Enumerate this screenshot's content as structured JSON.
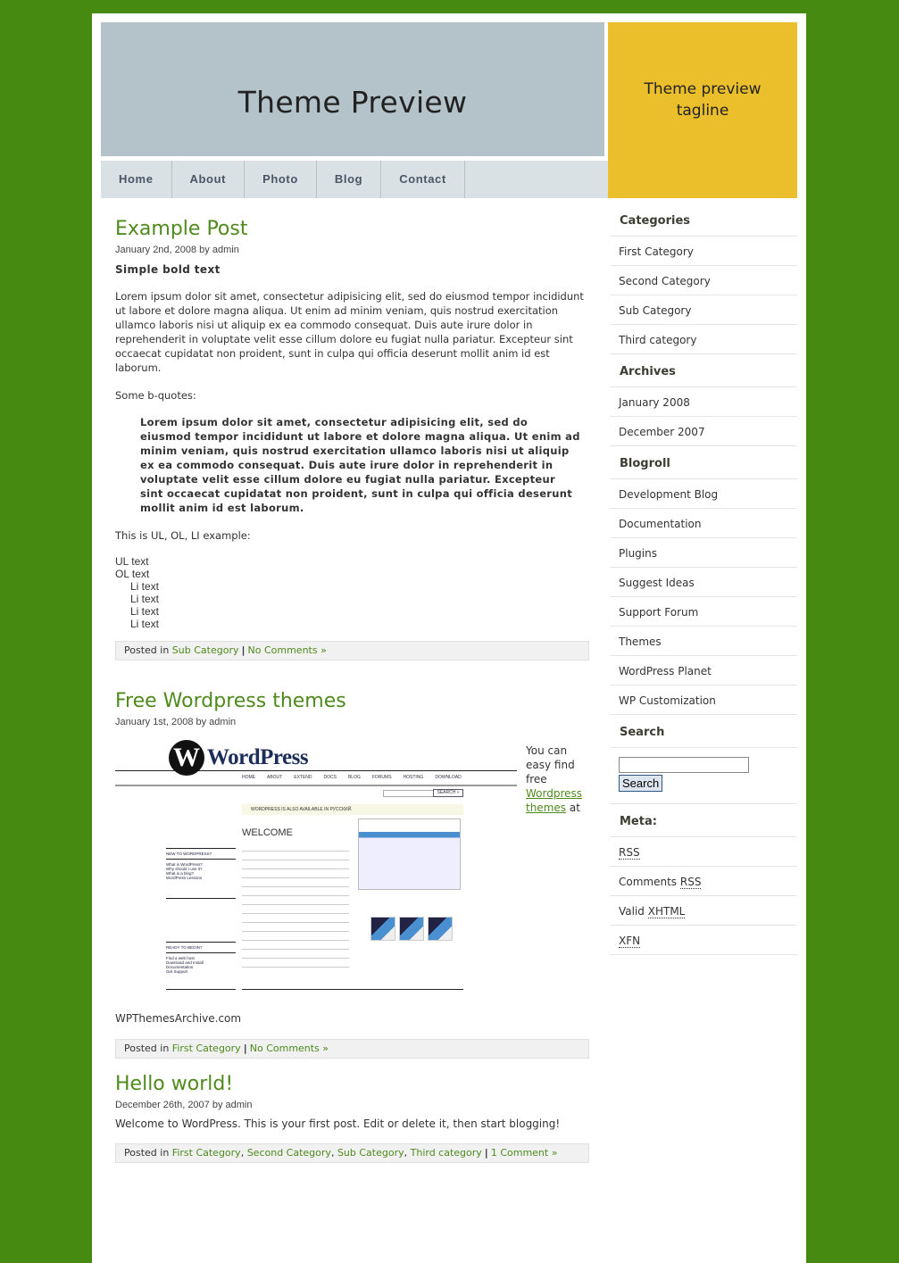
{
  "site": {
    "title": "Theme Preview",
    "tagline": "Theme preview tagline"
  },
  "colors": {
    "background": "#468a12",
    "header": "#b4c3c9",
    "tagline_box": "#ebbf2b",
    "nav": "#d9e1e5",
    "accent": "#4f8a1d"
  },
  "nav": [
    "Home",
    "About",
    "Photo",
    "Blog",
    "Contact"
  ],
  "posts": [
    {
      "title": "Example Post",
      "meta": "January 2nd, 2008 by admin",
      "bold": "Simple bold text",
      "para": "Lorem ipsum dolor sit amet, consectetur adipisicing elit, sed do eiusmod tempor incididunt ut labore et dolore magna aliqua. Ut enim ad minim veniam, quis nostrud exercitation ullamco laboris nisi ut aliquip ex ea commodo consequat. Duis aute irure dolor in reprehenderit in voluptate velit esse cillum dolore eu fugiat nulla pariatur. Excepteur sint occaecat cupidatat non proident, sunt in culpa qui officia deserunt mollit anim id est laborum.",
      "bq_intro": "Some b-quotes:",
      "blockquote": "Lorem ipsum dolor sit amet, consectetur adipisicing elit, sed do eiusmod tempor incididunt ut labore et dolore magna aliqua. Ut enim ad minim veniam, quis nostrud exercitation ullamco laboris nisi ut aliquip ex ea commodo consequat. Duis aute irure dolor in reprehenderit in voluptate velit esse cillum dolore eu fugiat nulla pariatur. Excepteur sint occaecat cupidatat non proident, sunt in culpa qui officia deserunt mollit anim id est laborum.",
      "list_intro": "This is UL, OL, LI example:",
      "ul": "UL text",
      "ol": "OL text",
      "li": [
        "Li text",
        "Li text",
        "Li text",
        "Li text"
      ],
      "posted_in": "Posted in",
      "categories": [
        "Sub Category"
      ],
      "comments": "No Comments »"
    },
    {
      "title": "Free Wordpress themes",
      "meta": "January 1st, 2008 by admin",
      "side_text": "You can easy find free",
      "side_link": "Wordpress themes",
      "side_after": "at",
      "caption": "WPThemesArchive.com",
      "posted_in": "Posted in",
      "categories": [
        "First Category"
      ],
      "comments": "No Comments »",
      "image": {
        "logo_text": "WordPress",
        "nav": [
          "HOME",
          "ABOUT",
          "EXTEND",
          "DOCS",
          "BLOG",
          "FORUMS",
          "HOSTING",
          "DOWNLOAD"
        ],
        "search": "SEARCH »",
        "notice": "WORDPRESS IS ALSO AVAILABLE IN РУССКИЙ.",
        "welcome": "WELCOME",
        "new_heading": "NEW TO WORDPRESS?",
        "new_links": [
          "What is WordPress?",
          "Why should I use it?",
          "What is a blog?",
          "WordPress Lessons"
        ],
        "ready_heading": "READY TO BEGIN?",
        "ready_links": [
          "Find a web host",
          "Download and Install",
          "Documentation",
          "Get Support"
        ]
      }
    },
    {
      "title": "Hello world!",
      "meta": "December 26th, 2007 by admin",
      "para": "Welcome to WordPress. This is your first post. Edit or delete it, then start blogging!",
      "posted_in": "Posted in",
      "categories": [
        "First Category",
        "Second Category",
        "Sub Category",
        "Third category"
      ],
      "comments": "1 Comment »"
    }
  ],
  "sidebar": {
    "categories": {
      "title": "Categories",
      "items": [
        "First Category",
        "Second Category",
        "Sub Category",
        "Third category"
      ]
    },
    "archives": {
      "title": "Archives",
      "items": [
        "January 2008",
        "December 2007"
      ]
    },
    "blogroll": {
      "title": "Blogroll",
      "items": [
        "Development Blog",
        "Documentation",
        "Plugins",
        "Suggest Ideas",
        "Support Forum",
        "Themes",
        "WordPress Planet",
        "WP Customization"
      ]
    },
    "search": {
      "title": "Search",
      "value": "",
      "button": "Search"
    },
    "meta": {
      "title": "Meta:",
      "rss": "RSS",
      "comments": "Comments",
      "comments_rss": "RSS",
      "valid": "Valid",
      "xhtml": "XHTML",
      "xfn": "XFN"
    }
  }
}
